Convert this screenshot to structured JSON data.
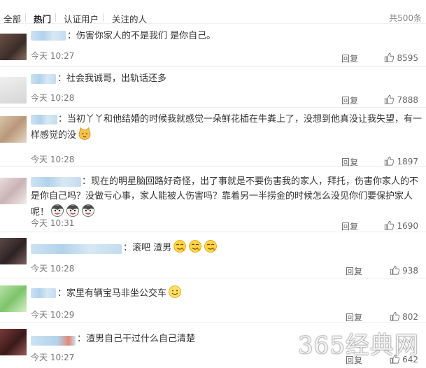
{
  "filter_tabs": [
    "全部",
    "热门",
    "认证用户",
    "关注的人"
  ],
  "active_tab": "热门",
  "total_count": "共500条",
  "reply_label": "回复",
  "comments": [
    {
      "text": "：伤害你家人的不是我们 是你自己。",
      "time": "今天 10:27",
      "likes": "8595"
    },
    {
      "text": "：社会我诚哥，出轨话还多",
      "time": "今天 10:28",
      "likes": "7888"
    },
    {
      "text": "：当初丫丫和他结婚的时候我就感觉一朵鲜花插在牛粪上了，没想到他真没让我失望，有一样感觉的没",
      "emoji": [
        "cat-emoji"
      ],
      "time": "今天 10:28",
      "likes": "1897"
    },
    {
      "text": "：现在的明星脑回路好奇怪，出了事就是不要伤害我的家人，拜托，伤害你家人的不是你自己吗？没做亏心事，家人能被人伤害吗？靠着另一半捞金的时候怎么没见你们要保护家人呢！",
      "emoji": [
        "husky-emoji",
        "husky-emoji",
        "husky-emoji"
      ],
      "time": "今天 10:31",
      "likes": "1690"
    },
    {
      "text": "：滚吧 渣男",
      "emoji": [
        "sly-emoji",
        "sly-emoji",
        "sly-emoji"
      ],
      "time": "今天 10:28",
      "likes": "938"
    },
    {
      "text": "：家里有辆宝马非坐公交车",
      "emoji": [
        "smile-emoji"
      ],
      "time": "今天 10:29",
      "likes": "802"
    },
    {
      "text": "：渣男自己干过什么自己清楚",
      "time": "今天 10:27",
      "likes": "642"
    }
  ],
  "watermark": "365经典网"
}
